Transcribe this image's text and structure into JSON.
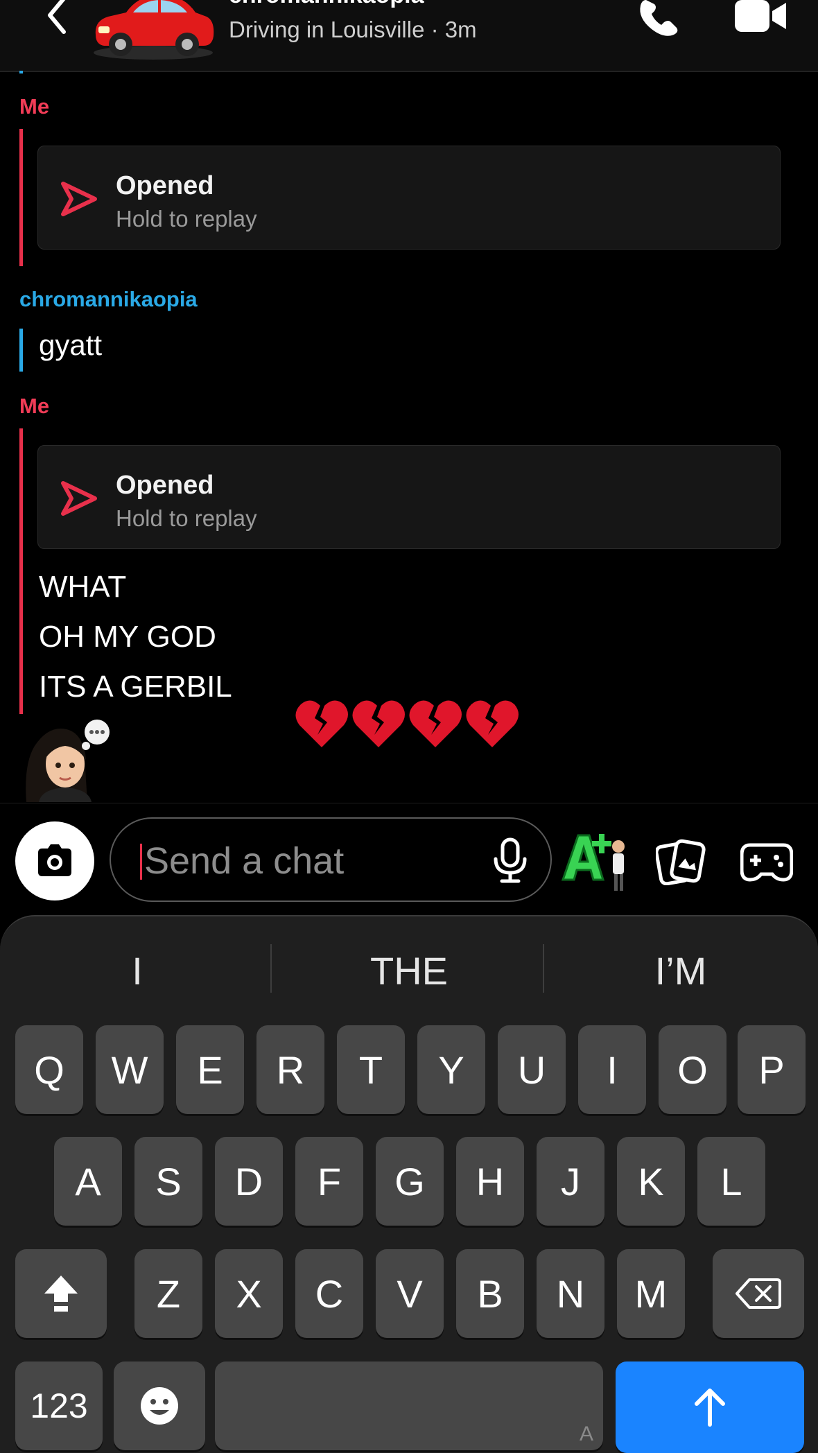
{
  "header": {
    "name": "chromannikaopia",
    "status": "Driving in Louisville · 3m"
  },
  "chat": {
    "blocks": [
      {
        "sender": "Me",
        "type": "snap",
        "title": "Opened",
        "subtitle": "Hold to replay"
      },
      {
        "sender": "chromannikaopia",
        "type": "text",
        "text": "gyatt"
      },
      {
        "sender": "Me",
        "type": "snap",
        "title": "Opened",
        "subtitle": "Hold to replay"
      },
      {
        "sender": "Me",
        "type": "text_lines",
        "lines": [
          "WHAT",
          "OH MY GOD",
          "ITS A GERBIL"
        ]
      }
    ],
    "reaction": "💔💔💔💔"
  },
  "input": {
    "placeholder": "Send a chat"
  },
  "keyboard": {
    "suggestions": [
      "I",
      "THE",
      "I’M"
    ],
    "row1": [
      "Q",
      "W",
      "E",
      "R",
      "T",
      "Y",
      "U",
      "I",
      "O",
      "P"
    ],
    "row2": [
      "A",
      "S",
      "D",
      "F",
      "G",
      "H",
      "J",
      "K",
      "L"
    ],
    "row3": [
      "Z",
      "X",
      "C",
      "V",
      "B",
      "N",
      "M"
    ],
    "numbers_key": "123",
    "space_hint": "A"
  },
  "colors": {
    "me": "#f23c57",
    "them": "#2aa9e6",
    "return_key": "#1a84ff"
  }
}
